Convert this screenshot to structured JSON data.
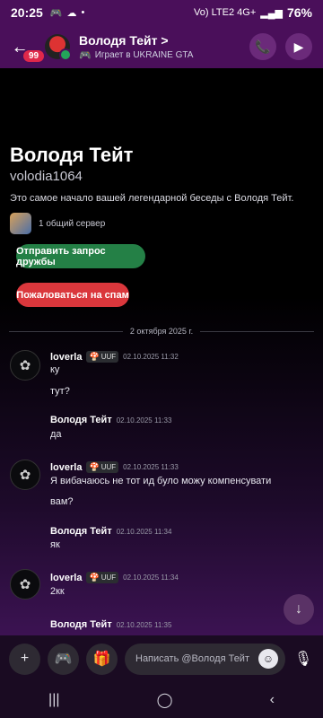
{
  "status": {
    "time": "20:25",
    "network": "Vo) LTE2 4G+",
    "battery": "76%"
  },
  "header": {
    "badge": "99",
    "name": "Володя Тейт >",
    "activity": "Играет в UKRAINE GTA",
    "icons": [
      "back-arrow-icon",
      "phone-call-icon",
      "video-camera-icon"
    ]
  },
  "intro": {
    "display_name": "Володя Тейт",
    "username": "volodia1064",
    "description": "Это самое начало вашей легендарной беседы с Володя Тейт.",
    "mutual_servers": "1 общий сервер"
  },
  "actions": {
    "friend_request": "Отправить запрос дружбы",
    "report_spam": "Пожаловаться на спам"
  },
  "date_divider": "2 октября 2025 г.",
  "messages": [
    {
      "author": "loverla",
      "tag": "UUF",
      "time": "02.10.2025 11:32",
      "lines": [
        "ку",
        "тут?"
      ]
    },
    {
      "author": "Володя Тейт",
      "time": "02.10.2025 11:33",
      "lines": [
        "да"
      ]
    },
    {
      "author": "loverla",
      "tag": "UUF",
      "time": "02.10.2025 11:33",
      "lines": [
        "Я вибачаюсь не тот ид було можу компенсувати",
        "вам?"
      ]
    },
    {
      "author": "Володя Тейт",
      "time": "02.10.2025 11:34",
      "lines": [
        "як"
      ]
    },
    {
      "author": "loverla",
      "tag": "UUF",
      "time": "02.10.2025 11:34",
      "lines": [
        "2кк"
      ]
    },
    {
      "author": "Володя Тейт",
      "time": "02.10.2025 11:35",
      "lines": []
    }
  ],
  "composer": {
    "placeholder": "Написать @Володя Тейт"
  },
  "colors": {
    "accent": "#4a0f5a",
    "green_button": "#248046",
    "red_button": "#da373c"
  }
}
